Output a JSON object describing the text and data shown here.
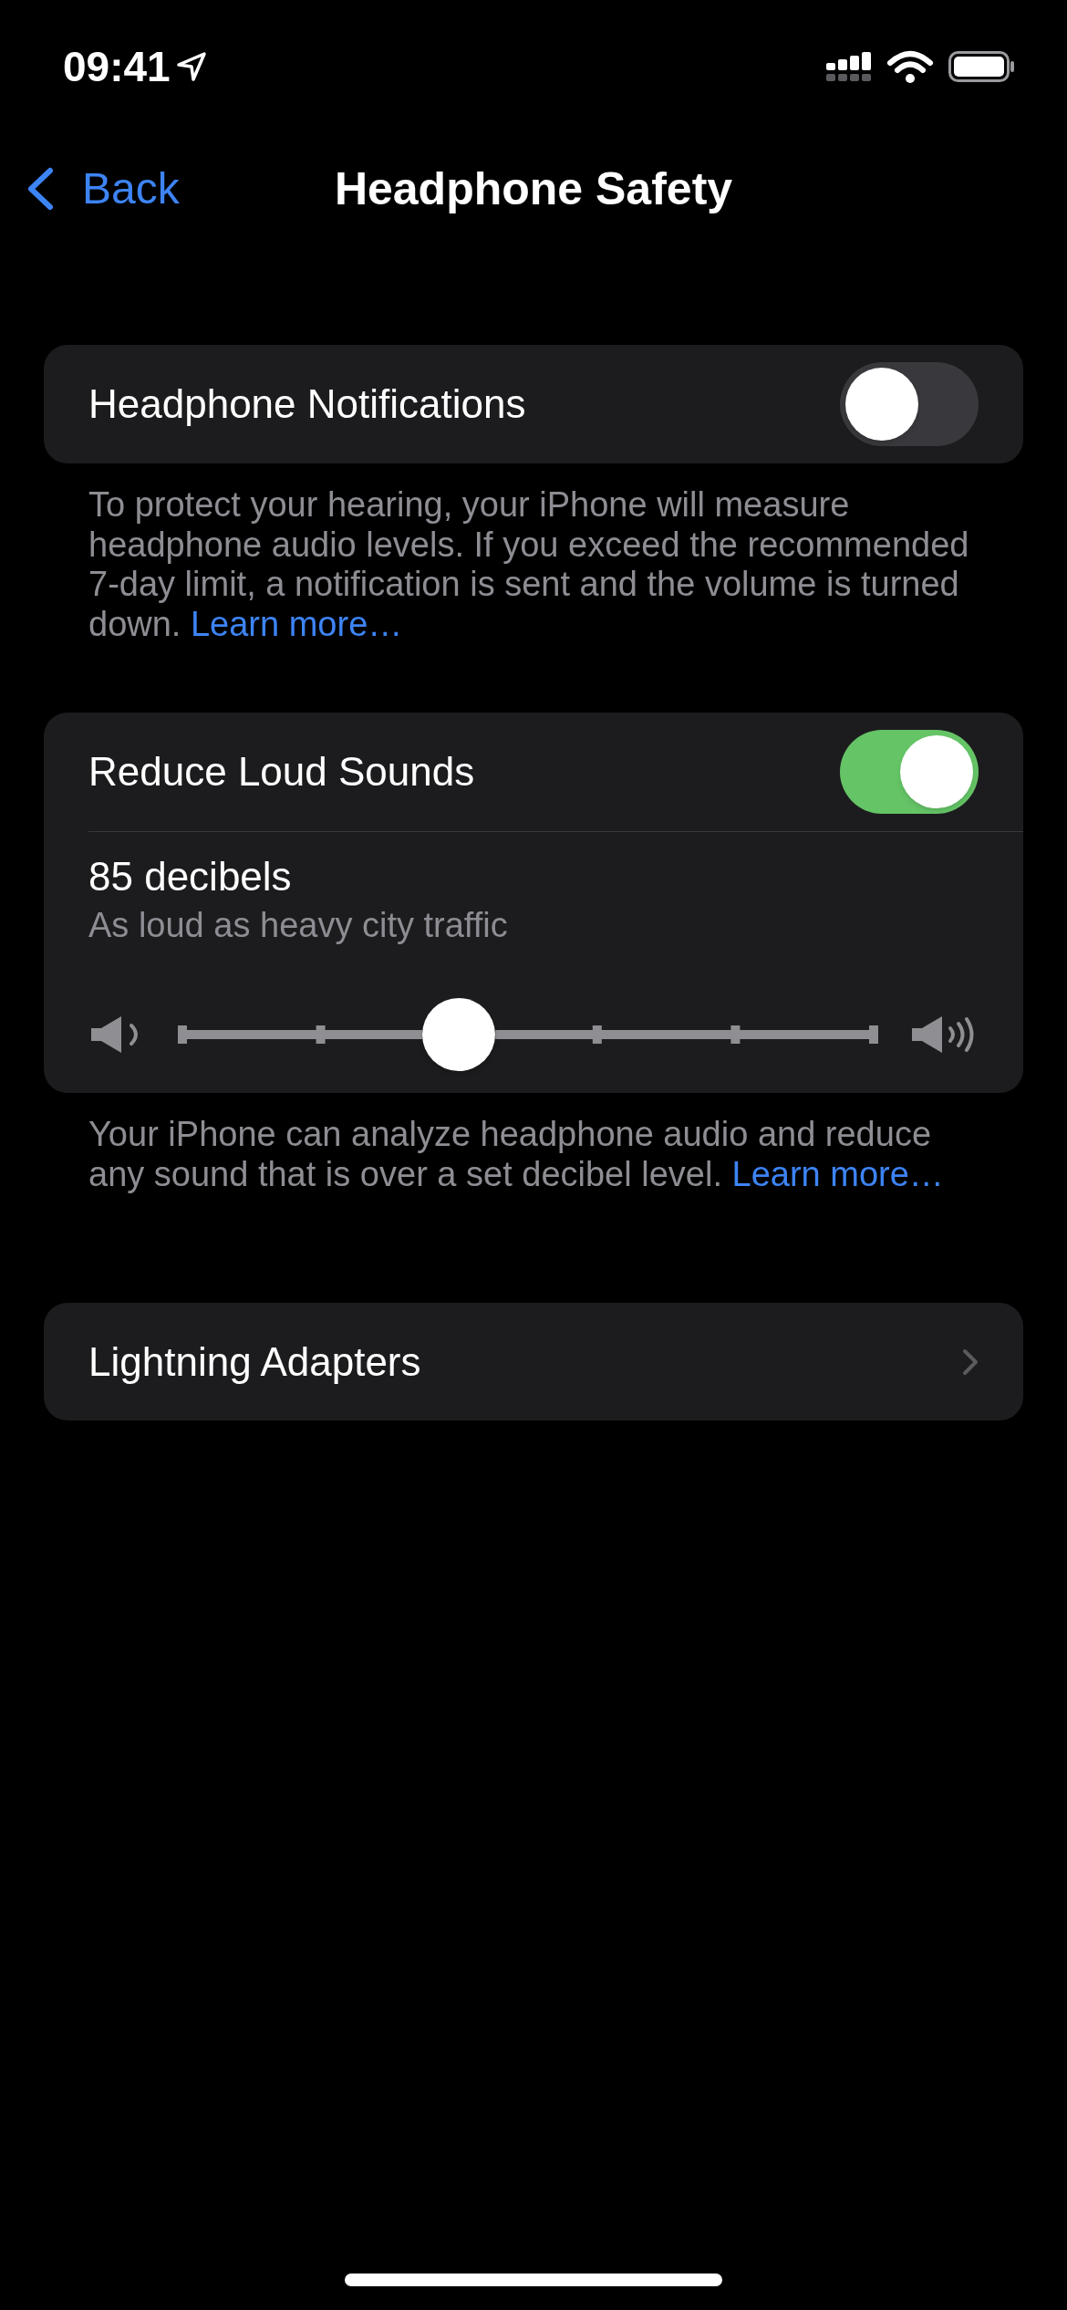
{
  "status_bar": {
    "time": "09:41"
  },
  "nav": {
    "back": "Back",
    "title": "Headphone Safety"
  },
  "groups": [
    {
      "rows": [
        {
          "kind": "toggle",
          "label": "Headphone Notifications",
          "on": false
        }
      ],
      "footer": {
        "text": "To protect your hearing, your iPhone will measure headphone audio levels. If you exceed the recommended 7-day limit, a notification is sent and the volume is turned down.",
        "link": "Learn more…"
      }
    },
    {
      "rows": [
        {
          "kind": "toggle",
          "label": "Reduce Loud Sounds",
          "on": true
        },
        {
          "kind": "slider",
          "title": "85 decibels",
          "subtitle": "As loud as heavy city traffic",
          "level": 0.4
        }
      ],
      "footer": {
        "text": "Your iPhone can analyze headphone audio and reduce any sound that is over a set decibel level.",
        "link": "Learn more…"
      }
    },
    {
      "rows": [
        {
          "kind": "link",
          "label": "Lightning Adapters"
        }
      ]
    }
  ]
}
